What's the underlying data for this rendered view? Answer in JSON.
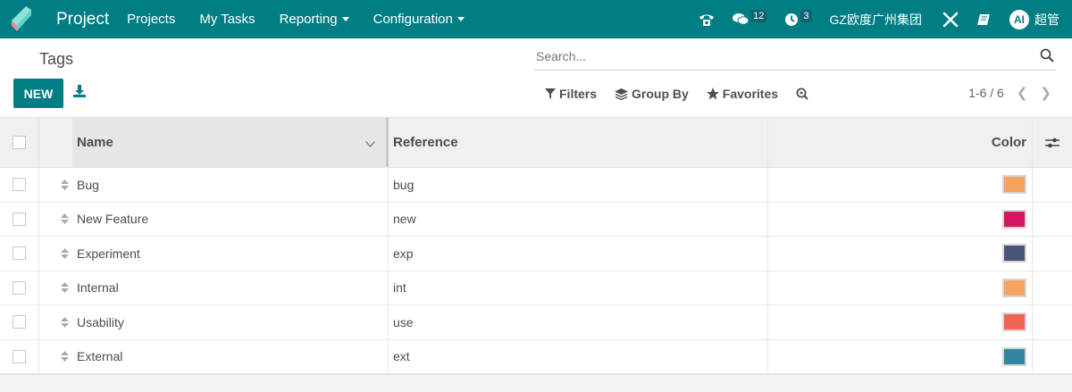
{
  "navbar": {
    "app_name": "Project",
    "menu": [
      {
        "label": "Projects"
      },
      {
        "label": "My Tasks"
      },
      {
        "label": "Reporting"
      },
      {
        "label": "Configuration"
      }
    ],
    "messages_count": "12",
    "activities_count": "3",
    "company": "GZ欧度广州集团",
    "avatar_initials": "AI",
    "user": "超管"
  },
  "control": {
    "breadcrumb": "Tags",
    "new_label": "NEW",
    "search_placeholder": "Search...",
    "filters_label": "Filters",
    "groupby_label": "Group By",
    "favorites_label": "Favorites",
    "pager": "1-6 / 6"
  },
  "table": {
    "headers": {
      "name": "Name",
      "reference": "Reference",
      "color": "Color"
    },
    "rows": [
      {
        "name": "Bug",
        "reference": "bug",
        "color": "#f4a460"
      },
      {
        "name": "New Feature",
        "reference": "new",
        "color": "#d6145f"
      },
      {
        "name": "Experiment",
        "reference": "exp",
        "color": "#475577"
      },
      {
        "name": "Internal",
        "reference": "int",
        "color": "#f4a460"
      },
      {
        "name": "Usability",
        "reference": "use",
        "color": "#ee6452"
      },
      {
        "name": "External",
        "reference": "ext",
        "color": "#30869e"
      }
    ]
  },
  "colors": {
    "brand": "#017e84"
  }
}
